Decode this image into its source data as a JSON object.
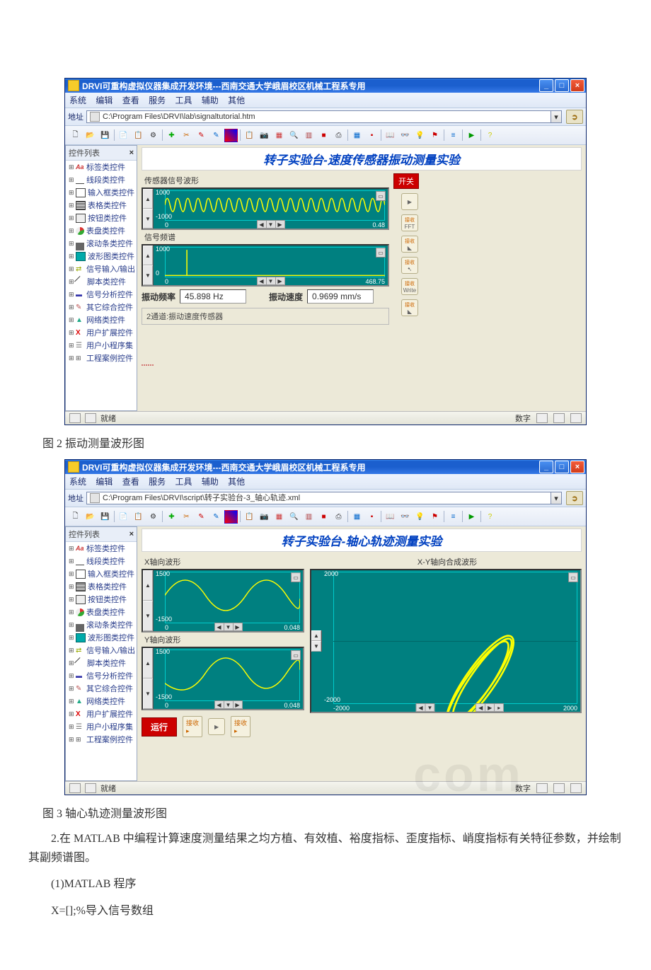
{
  "app1": {
    "title": "DRVI可重构虚拟仪器集成开发环境---西南交通大学峨眉校区机械工程系专用",
    "menus": [
      "系统",
      "编辑",
      "查看",
      "服务",
      "工具",
      "辅助",
      "其他"
    ],
    "address_label": "地址",
    "address_value": "C:\\Program Files\\DRVI\\lab\\signaltutorial.htm",
    "sidebar_title": "控件列表",
    "tree": [
      "标签类控件",
      "线段类控件",
      "输入框类控件",
      "表格类控件",
      "按钮类控件",
      "表盘类控件",
      "滚动条类控件",
      "波形图类控件",
      "信号输入/输出",
      "脚本类控件",
      "信号分析控件",
      "其它综合控件",
      "网络类控件",
      "用户扩展控件",
      "用户小程序集",
      "工程案例控件"
    ],
    "experiment_title": "转子实验台-速度传感器振动测量实验",
    "scope1_label": "传感器信号波形",
    "scope1_y_top": "1000",
    "scope1_y_bot": "-1000",
    "scope1_x_left": "0",
    "scope1_x_right": "0.48",
    "scope2_label": "信号频谱",
    "scope2_y_top": "1000",
    "scope2_y_bot": "0",
    "scope2_x_left": "0",
    "scope2_x_right": "468.75",
    "switch_label": "开关",
    "side_buttons": [
      "",
      "接收\nFFT",
      "接收",
      "接收",
      "接收\nWrite",
      "接收"
    ],
    "freq_label": "振动频率",
    "freq_value": "45.898 Hz",
    "speed_label": "振动速度",
    "speed_value": "0.9699 mm/s",
    "footer_text": "2通道:振动速度传感器",
    "status_ready": "就绪",
    "status_num": "数字"
  },
  "caption_fig2": "图 2 振动测量波形图",
  "app2": {
    "title": "DRVI可重构虚拟仪器集成开发环境---西南交通大学峨眉校区机械工程系专用",
    "menus": [
      "系统",
      "编辑",
      "查看",
      "服务",
      "工具",
      "辅助",
      "其他"
    ],
    "address_label": "地址",
    "address_value": "C:\\Program Files\\DRVI\\script\\转子实验台-3_轴心轨迹.xml",
    "sidebar_title": "控件列表",
    "tree": [
      "标签类控件",
      "线段类控件",
      "输入框类控件",
      "表格类控件",
      "按钮类控件",
      "表盘类控件",
      "滚动条类控件",
      "波形图类控件",
      "信号输入/输出",
      "脚本类控件",
      "信号分析控件",
      "其它综合控件",
      "网络类控件",
      "用户扩展控件",
      "用户小程序集",
      "工程案例控件"
    ],
    "experiment_title": "转子实验台-轴心轨迹测量实验",
    "scopeX_label": "X轴向波形",
    "scopeY_label": "Y轴向波形",
    "scopeXY_label": "X-Y轴向合成波形",
    "scopeX_y_top": "1500",
    "scopeX_y_bot": "-1500",
    "scopeX_x_left": "0",
    "scopeX_x_right": "0.048",
    "scopeY_y_top": "1500",
    "scopeY_y_bot": "-1500",
    "scopeY_x_left": "0",
    "scopeY_x_right": "0.048",
    "scopeXY_y_top": "2000",
    "scopeXY_y_bot": "-2000",
    "scopeXY_x_left": "-2000",
    "scopeXY_x_right": "2000",
    "run_label": "运行",
    "status_ready": "就绪",
    "status_num": "数字"
  },
  "caption_fig3": "图 3 轴心轨迹测量波形图",
  "para1": "2.在 MATLAB 中编程计算速度测量结果之均方植、有效植、裕度指标、歪度指标、峭度指标有关特征参数，并绘制其副频谱图。",
  "para2": "(1)MATLAB 程序",
  "para3": "X=[];%导入信号数组",
  "chart_data": [
    {
      "type": "line",
      "title": "传感器信号波形",
      "xlim": [
        0,
        0.48
      ],
      "ylim": [
        -1000,
        1000
      ],
      "xlabel": "",
      "ylabel": "",
      "note": "periodic waveform approx 22 cycles across span (≈46 Hz)"
    },
    {
      "type": "line",
      "title": "信号频谱",
      "xlim": [
        0,
        468.75
      ],
      "ylim": [
        0,
        1000
      ],
      "xlabel": "",
      "ylabel": "",
      "peaks": [
        {
          "x": 45.898,
          "y": 900
        }
      ]
    },
    {
      "type": "line",
      "title": "X轴向波形",
      "xlim": [
        0,
        0.048
      ],
      "ylim": [
        -1500,
        1500
      ],
      "note": "approx 2 cycles sinusoid"
    },
    {
      "type": "line",
      "title": "Y轴向波形",
      "xlim": [
        0,
        0.048
      ],
      "ylim": [
        -1500,
        1500
      ],
      "note": "approx 2 cycles sinusoid phase-shifted"
    },
    {
      "type": "scatter",
      "title": "X-Y轴向合成波形",
      "xlim": [
        -2000,
        2000
      ],
      "ylim": [
        -2000,
        2000
      ],
      "note": "elongated elliptical orbit trajectory"
    }
  ]
}
